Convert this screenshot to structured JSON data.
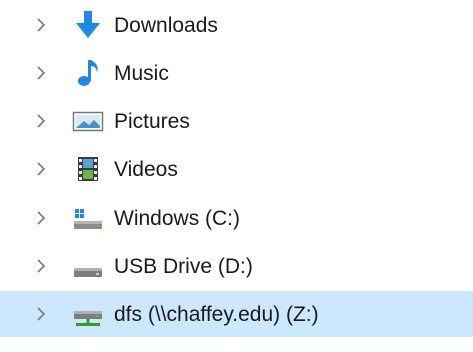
{
  "nav_tree": {
    "items": [
      {
        "label": "Downloads",
        "icon": "downloads-icon",
        "selected": false
      },
      {
        "label": "Music",
        "icon": "music-icon",
        "selected": false
      },
      {
        "label": "Pictures",
        "icon": "pictures-icon",
        "selected": false
      },
      {
        "label": "Videos",
        "icon": "videos-icon",
        "selected": false
      },
      {
        "label": "Windows (C:)",
        "icon": "windows-drive-icon",
        "selected": false
      },
      {
        "label": "USB Drive (D:)",
        "icon": "usb-drive-icon",
        "selected": false
      },
      {
        "label": "dfs (\\\\chaffey.edu) (Z:)",
        "icon": "network-drive-icon",
        "selected": true
      }
    ]
  },
  "colors": {
    "selection_background": "#cce8ff",
    "chevron": "#7a7a7a",
    "text": "#1a1a1a",
    "accent_blue": "#1e88e5"
  }
}
